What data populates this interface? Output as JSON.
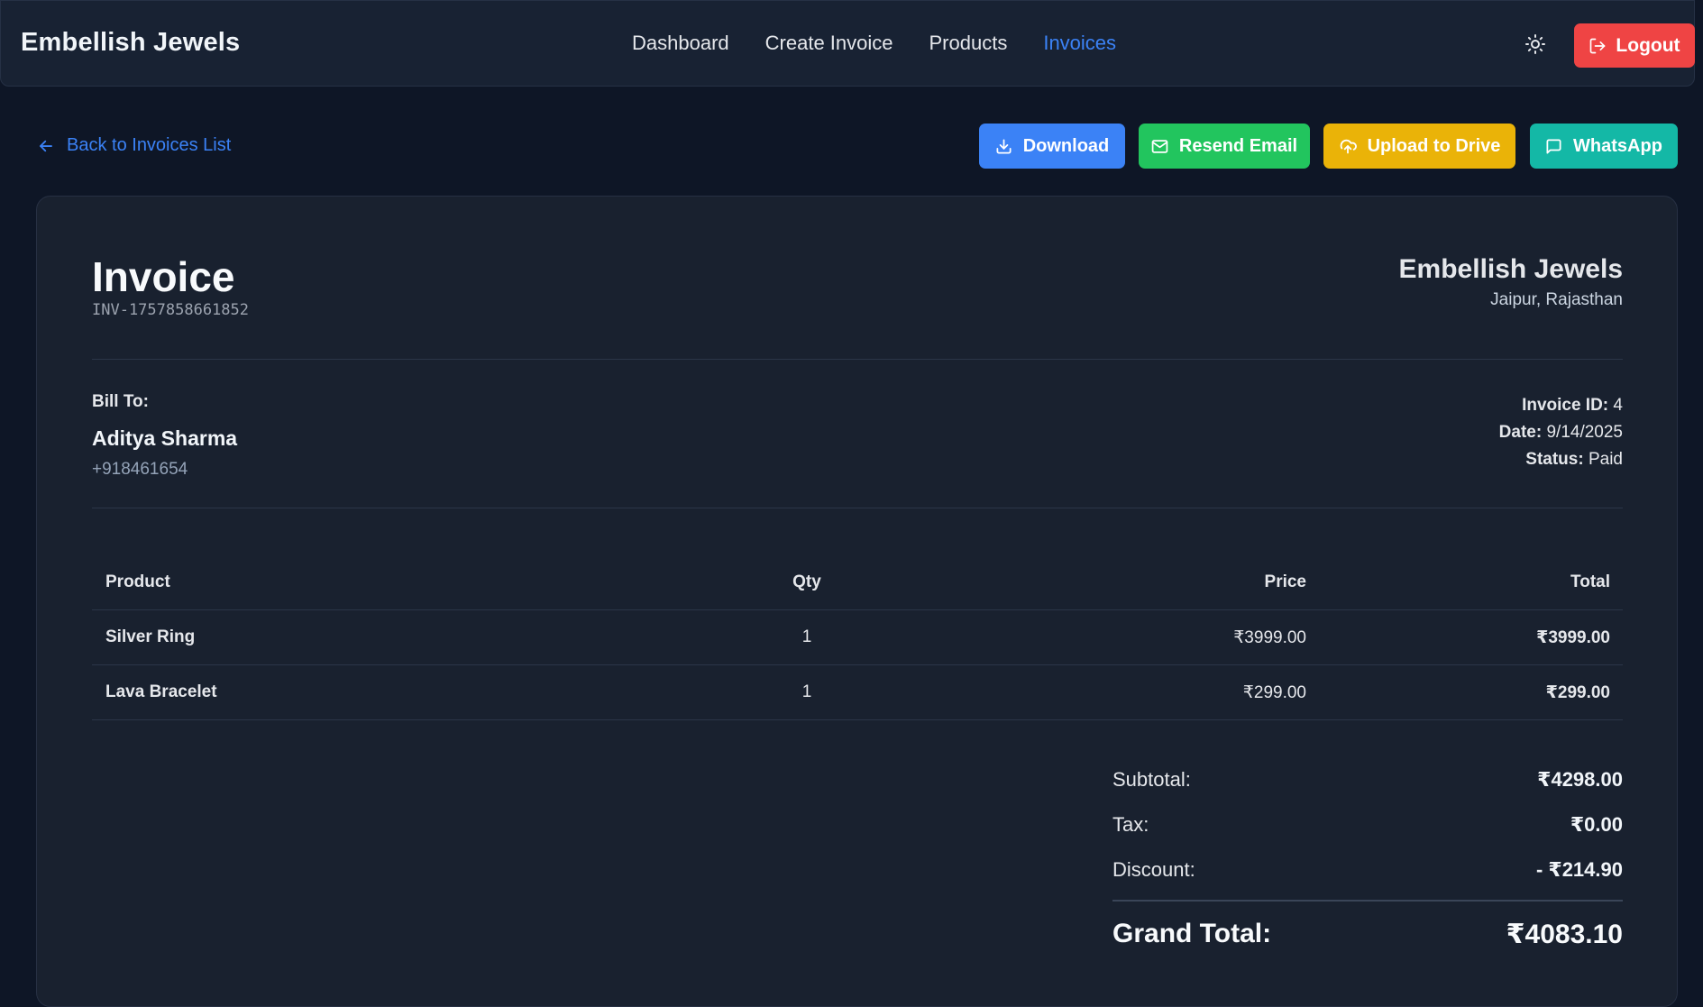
{
  "header": {
    "brand": "Embellish Jewels",
    "nav": [
      "Dashboard",
      "Create Invoice",
      "Products",
      "Invoices"
    ],
    "active_nav": "Invoices",
    "logout_label": "Logout"
  },
  "actions": {
    "back_label": "Back to Invoices List",
    "download_label": "Download",
    "resend_label": "Resend Email",
    "drive_label": "Upload to Drive",
    "whatsapp_label": "WhatsApp"
  },
  "invoice": {
    "title": "Invoice",
    "number": "INV-1757858661852",
    "company": "Embellish Jewels",
    "company_location": "Jaipur, Rajasthan",
    "bill_to_label": "Bill To:",
    "customer_name": "Aditya Sharma",
    "customer_phone": "+918461654",
    "invoice_id_label": "Invoice ID:",
    "invoice_id": "4",
    "date_label": "Date:",
    "date": "9/14/2025",
    "status_label": "Status:",
    "status": "Paid"
  },
  "table": {
    "headers": {
      "product": "Product",
      "qty": "Qty",
      "price": "Price",
      "total": "Total"
    },
    "rows": [
      {
        "product": "Silver Ring",
        "qty": "1",
        "price": "₹3999.00",
        "total": "₹3999.00"
      },
      {
        "product": "Lava Bracelet",
        "qty": "1",
        "price": "₹299.00",
        "total": "₹299.00"
      }
    ]
  },
  "totals": {
    "subtotal_label": "Subtotal:",
    "subtotal": "₹4298.00",
    "tax_label": "Tax:",
    "tax": "₹0.00",
    "discount_label": "Discount:",
    "discount": "- ₹214.90",
    "grand_label": "Grand Total:",
    "grand": "₹4083.10"
  },
  "colors": {
    "accent": "#3b82f6",
    "logout": "#ef4444",
    "email": "#22c55e",
    "drive": "#eab308",
    "whatsapp": "#14b8a6"
  }
}
